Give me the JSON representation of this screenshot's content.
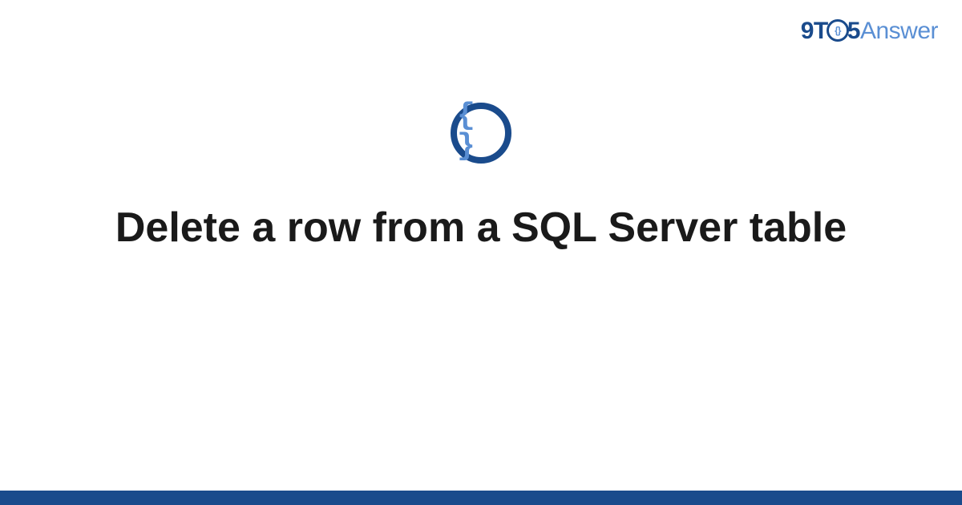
{
  "logo": {
    "part1": "9T",
    "circle_inner": "{}",
    "part2": "5",
    "part3": "Answer"
  },
  "icon": {
    "name": "code-braces-icon",
    "glyph": "{ }"
  },
  "title": "Delete a row from a SQL Server table",
  "colors": {
    "dark_blue": "#1a4b8c",
    "light_blue": "#5a8fd4",
    "text": "#1a1a1a",
    "background": "#ffffff"
  }
}
